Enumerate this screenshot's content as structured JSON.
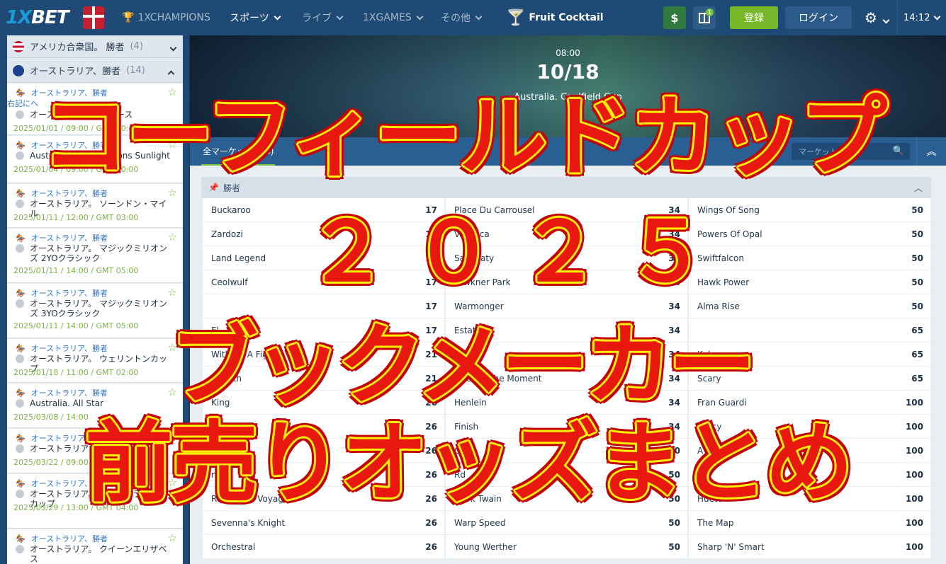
{
  "nav": {
    "logo_a": "1X",
    "logo_b": "BET",
    "champions": "1XCHAMPIONS",
    "sports": "スポーツ",
    "live": "ライブ",
    "games": "1XGAMES",
    "other": "その他",
    "featured": "Fruit Cocktail",
    "dollar": "$",
    "gift_badge": "1",
    "register": "登録",
    "login": "ログイン",
    "time": "14:12"
  },
  "sidebar": {
    "groups": [
      {
        "label": "アメリカ合衆国。 勝者",
        "count": "(4)"
      },
      {
        "label": "オーストラリア、勝者",
        "count": "(14)"
      }
    ],
    "note": "右記にへ",
    "items": [
      {
        "cat": "オーストラリア、勝者",
        "name": "オーストラリア。 ニュース",
        "date": "2025/01/01 / 09:00 / GMT 00:00"
      },
      {
        "cat": "オーストラリア、勝者",
        "name": "Australia. Magic Millions Sunlight",
        "date": "2025/01/04 / 09:00 / GMT 00:00"
      },
      {
        "cat": "オーストラリア、勝者",
        "name": "オーストラリア。 ソーンドン・マイル",
        "date": "2025/01/11 / 12:00 / GMT 03:00"
      },
      {
        "cat": "オーストラリア、勝者",
        "name": "オーストラリア。 マジックミリオンズ 2YOクラシック",
        "date": "2025/01/11 / 14:00 / GMT 05:00"
      },
      {
        "cat": "オーストラリア、勝者",
        "name": "オーストラリア。 マジックミリオンズ 3YOクラシック",
        "date": "2025/01/11 / 14:00 / GMT 05:00"
      },
      {
        "cat": "オーストラリア、勝者",
        "name": "オーストラリア。 ウェリントンカップ",
        "date": "2025/01/18 / 11:00 / GMT 02:00"
      },
      {
        "cat": "オーストラリア、勝者",
        "name": "Australia. All Star",
        "date": "2025/03/08 / 14:00"
      },
      {
        "cat": "オーストラリア、勝者",
        "name": "オーストラリア",
        "date": "2025/03/22 / 09:00"
      },
      {
        "cat": "オーストラリア、勝者",
        "name": "オーストラリア。 オーストラリア・カップ",
        "date": "2025/03/29 / 13:00 / GMT 04:00"
      },
      {
        "cat": "オーストラリア、勝者",
        "name": "オーストラリア。 クイーンエリザベス",
        "date": ""
      }
    ]
  },
  "hero": {
    "time": "08:00",
    "date": "10/18",
    "event": "Australia. Caulfield Cup"
  },
  "markets": {
    "tab": "全マーケット (66)",
    "search_placeholder": "マーケットを検索",
    "group": "勝者"
  },
  "runners": [
    [
      {
        "name": "Buckaroo",
        "odd": "17"
      },
      {
        "name": "Zardozi",
        "odd": "17"
      },
      {
        "name": "Land Legend",
        "odd": "17"
      },
      {
        "name": "Ceolwulf",
        "odd": "17"
      },
      {
        "name": "",
        "odd": "17"
      },
      {
        "name": "El",
        "odd": "17"
      },
      {
        "name": "Without A Fight",
        "odd": "21"
      },
      {
        "name": "Goliath",
        "odd": "21"
      },
      {
        "name": "King",
        "odd": "26"
      },
      {
        "name": "Princess",
        "odd": "26"
      },
      {
        "name": "",
        "odd": "26"
      },
      {
        "name": "n",
        "odd": "26"
      },
      {
        "name": "Relentless Voyager",
        "odd": "26"
      },
      {
        "name": "Sevenna's Knight",
        "odd": "26"
      },
      {
        "name": "Orchestral",
        "odd": "26"
      }
    ],
    [
      {
        "name": "Place Du Carrousel",
        "odd": "34"
      },
      {
        "name": "Vavalica",
        "odd": "34"
      },
      {
        "name": "Sayedaty",
        "odd": "34"
      },
      {
        "name": "Fawkner Park",
        "odd": "34"
      },
      {
        "name": "Warmonger",
        "odd": "34"
      },
      {
        "name": "Estates",
        "odd": "34"
      },
      {
        "name": "Tastic",
        "odd": "34"
      },
      {
        "name": "Treasurethe Moment",
        "odd": "34"
      },
      {
        "name": "Henlein",
        "odd": "34"
      },
      {
        "name": "Finish",
        "odd": "34"
      },
      {
        "name": "Coco",
        "odd": "50"
      },
      {
        "name": "Rd",
        "odd": "50"
      },
      {
        "name": "Mark Twain",
        "odd": "50"
      },
      {
        "name": "Warp Speed",
        "odd": "50"
      },
      {
        "name": "Young Werther",
        "odd": "50"
      }
    ],
    [
      {
        "name": "Wings Of Song",
        "odd": "50"
      },
      {
        "name": "Powers Of Opal",
        "odd": "50"
      },
      {
        "name": "Swiftfalcon",
        "odd": "50"
      },
      {
        "name": "Hawk Power",
        "odd": "50"
      },
      {
        "name": "Alma Rise",
        "odd": "50"
      },
      {
        "name": "",
        "odd": "65"
      },
      {
        "name": "Kalapour",
        "odd": "65"
      },
      {
        "name": "Scary",
        "odd": "65"
      },
      {
        "name": "Fran Guardi",
        "odd": "100"
      },
      {
        "name": "Fancy",
        "odd": "100"
      },
      {
        "name": "A",
        "odd": "100"
      },
      {
        "name": "Mi",
        "odd": "100"
      },
      {
        "name": "Hueto",
        "odd": "100"
      },
      {
        "name": "The Map",
        "odd": "100"
      },
      {
        "name": "Sharp 'N' Smart",
        "odd": "100"
      }
    ]
  ],
  "overlay": {
    "line1": "コーフィールドカップ",
    "line2": "２０２５",
    "line3": "ブックメーカー",
    "line4": "前売りオッズまとめ"
  }
}
